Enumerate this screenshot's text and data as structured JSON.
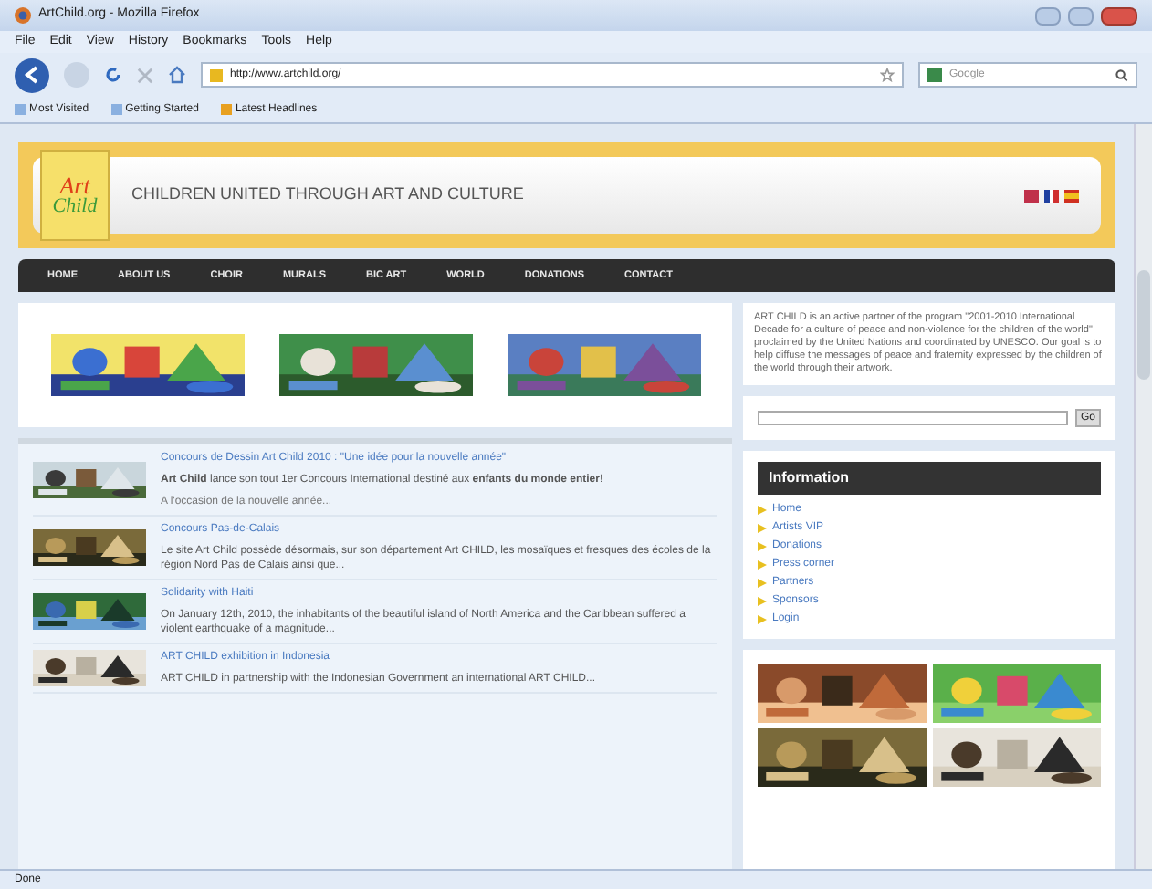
{
  "window": {
    "title": "ArtChild.org - Mozilla Firefox"
  },
  "menu": [
    "File",
    "Edit",
    "View",
    "History",
    "Bookmarks",
    "Tools",
    "Help"
  ],
  "address": {
    "value": "http://www.artchild.org/"
  },
  "search": {
    "placeholder": "Google"
  },
  "bookmarks": [
    "Most Visited",
    "Getting Started",
    "Latest Headlines"
  ],
  "header": {
    "logo_top": "Art",
    "logo_bottom": "Child",
    "tagline": "CHILDREN UNITED THROUGH ART AND CULTURE"
  },
  "nav": [
    "HOME",
    "ABOUT US",
    "CHOIR",
    "MURALS",
    "BIC ART",
    "WORLD",
    "DONATIONS",
    "CONTACT"
  ],
  "news": [
    {
      "title": "Concours de Dessin Art Child 2010 : \"Une idée pour la nouvelle année\"",
      "body": "**Art Child** lance son tout 1er Concours International destiné aux **enfants du monde entier**!",
      "extra": "A l'occasion de la nouvelle année..."
    },
    {
      "title": "Concours Pas-de-Calais",
      "body": "Le site Art Child possède désormais, sur son département Art CHILD, les mosaïques et fresques des écoles de la région Nord Pas de Calais ainsi que..."
    },
    {
      "title": "Solidarity with Haiti",
      "body": "On January 12th, 2010, the inhabitants of the beautiful island of North America and the Caribbean suffered a violent earthquake of a magnitude..."
    },
    {
      "title": "ART CHILD exhibition in Indonesia",
      "body": "ART CHILD in partnership with the Indonesian Government an international ART CHILD..."
    }
  ],
  "about": "ART CHILD is an active partner of the program \"2001-2010 International Decade for a culture of peace and non-violence for the children of the world\" proclaimed by the United Nations and coordinated by UNESCO. Our goal is to help diffuse the messages of peace and fraternity expressed by the children of the world through their artwork.",
  "site_search": {
    "button": "Go"
  },
  "information": {
    "title": "Information",
    "items": [
      "Home",
      "Artists VIP",
      "Donations",
      "Press corner",
      "Partners",
      "Sponsors",
      "Login"
    ]
  },
  "status_bar": "Done"
}
